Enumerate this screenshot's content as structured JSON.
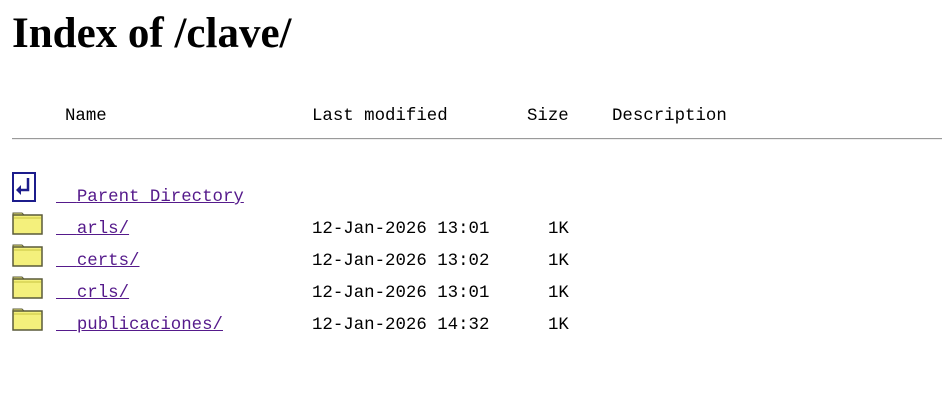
{
  "title": "Index of /clave/",
  "columns": {
    "name": "Name",
    "last_modified": "Last modified",
    "size": "Size",
    "description": "Description"
  },
  "parent": {
    "label": "Parent Directory",
    "icon": "back-arrow-icon"
  },
  "entries": [
    {
      "name": "arls/",
      "modified": "12-Jan-2026 13:01",
      "size": "1K",
      "icon": "folder-icon"
    },
    {
      "name": "certs/",
      "modified": "12-Jan-2026 13:02",
      "size": "1K",
      "icon": "folder-icon"
    },
    {
      "name": "crls/",
      "modified": "12-Jan-2026 13:01",
      "size": "1K",
      "icon": "folder-icon"
    },
    {
      "name": "publicaciones/",
      "modified": "12-Jan-2026 14:32",
      "size": "1K",
      "icon": "folder-icon"
    }
  ],
  "colors": {
    "link": "#551a8b",
    "folder_fill": "#f4f07c",
    "folder_outline": "#5a5a3a",
    "icon_blue": "#1c1c8c"
  }
}
